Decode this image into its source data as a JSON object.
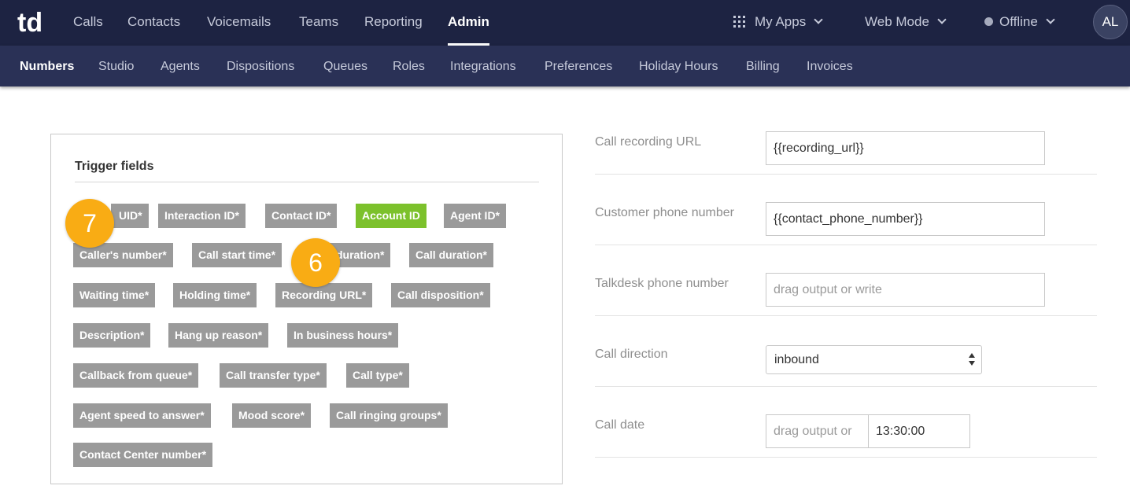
{
  "topnav": {
    "logo": "td",
    "items": [
      {
        "label": "Calls"
      },
      {
        "label": "Contacts"
      },
      {
        "label": "Voicemails"
      },
      {
        "label": "Teams"
      },
      {
        "label": "Reporting"
      },
      {
        "label": "Admin"
      }
    ],
    "my_apps": "My Apps",
    "web_mode": "Web Mode",
    "status": "Offline",
    "avatar": "AL"
  },
  "subnav": {
    "items": [
      {
        "label": "Numbers"
      },
      {
        "label": "Studio"
      },
      {
        "label": "Agents"
      },
      {
        "label": "Dispositions"
      },
      {
        "label": "Queues"
      },
      {
        "label": "Roles"
      },
      {
        "label": "Integrations"
      },
      {
        "label": "Preferences"
      },
      {
        "label": "Holiday Hours"
      },
      {
        "label": "Billing"
      },
      {
        "label": "Invoices"
      }
    ]
  },
  "trigger": {
    "title": "Trigger fields",
    "tags": [
      "UID*",
      "Interaction ID*",
      "Contact ID*",
      "Account ID",
      "Agent ID*",
      "Caller's number*",
      "Call start time*",
      "duration*",
      "Call duration*",
      "Waiting time*",
      "Holding time*",
      "Recording URL*",
      "Call disposition*",
      "Description*",
      "Hang up reason*",
      "In business hours*",
      "Callback from queue*",
      "Call transfer type*",
      "Call type*",
      "Agent speed to answer*",
      "Mood score*",
      "Call ringing groups*",
      "Contact Center number*"
    ],
    "badges": [
      "7",
      "6"
    ]
  },
  "form": {
    "rows": [
      {
        "label": "Call recording URL",
        "value": "{{recording_url}}",
        "placeholder": ""
      },
      {
        "label": "Customer phone number",
        "value": "{{contact_phone_number}}",
        "placeholder": ""
      },
      {
        "label": "Talkdesk phone number",
        "value": "",
        "placeholder": "drag output or write"
      },
      {
        "label": "Call direction",
        "value": "inbound"
      },
      {
        "label": "Call date",
        "date_placeholder": "drag output or",
        "time_value": "13:30:00"
      }
    ]
  },
  "colors": {
    "topbar": "#1d2342",
    "subbar": "#2a3156",
    "tag": "#9a9a9a",
    "tag_active": "#7cc12c",
    "badge": "#f9ac14"
  }
}
